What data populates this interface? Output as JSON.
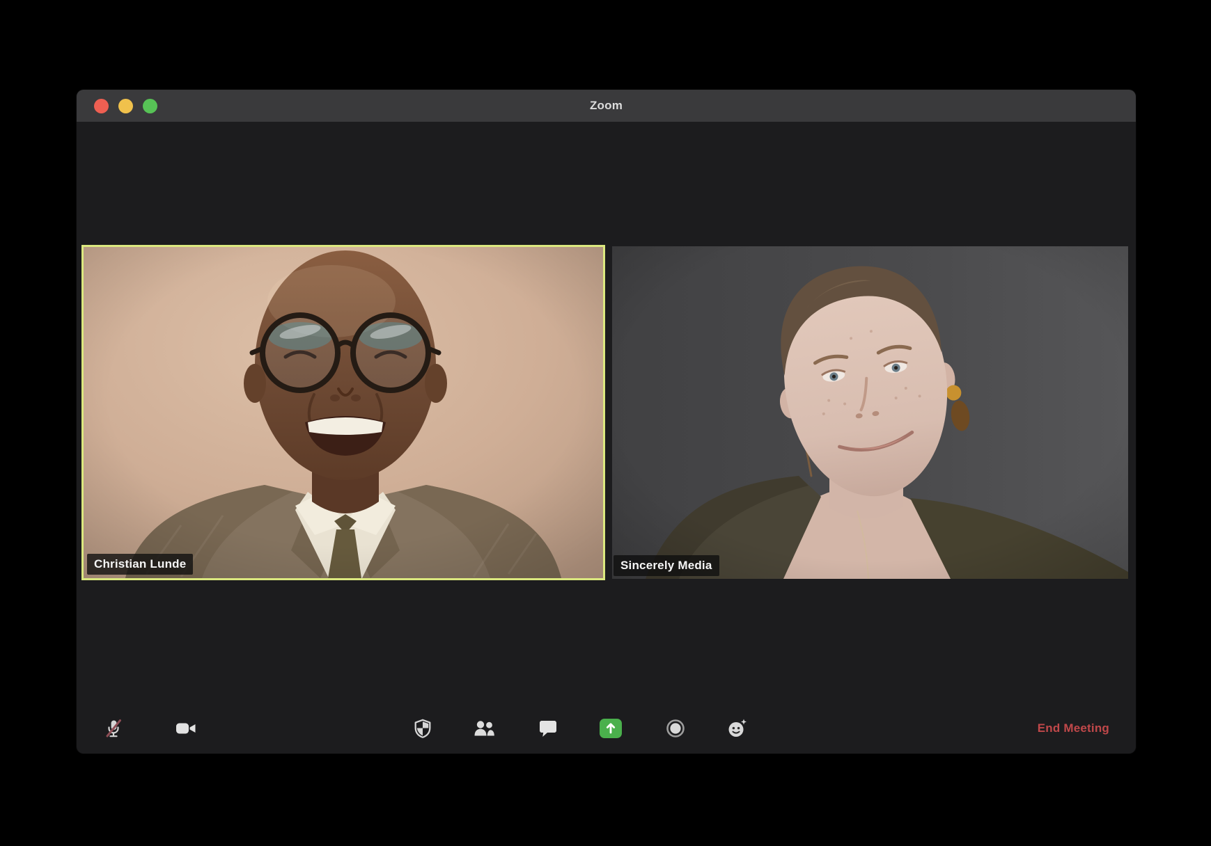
{
  "window": {
    "title": "Zoom"
  },
  "traffic_lights": [
    {
      "id": "close",
      "color": "#ee5f52"
    },
    {
      "id": "minimize",
      "color": "#f0c14c"
    },
    {
      "id": "fullscreen",
      "color": "#57c256"
    }
  ],
  "participants": [
    {
      "name": "Christian Lunde",
      "active_speaker": true
    },
    {
      "name": "Sincerely Media",
      "active_speaker": false
    }
  ],
  "toolbar": {
    "buttons": [
      {
        "id": "mute",
        "icon": "microphone-muted-icon",
        "state": "muted"
      },
      {
        "id": "video",
        "icon": "video-camera-icon"
      },
      {
        "id": "security",
        "icon": "security-shield-icon"
      },
      {
        "id": "participants",
        "icon": "participants-icon"
      },
      {
        "id": "chat",
        "icon": "chat-bubble-icon"
      },
      {
        "id": "share-screen",
        "icon": "share-screen-icon"
      },
      {
        "id": "record",
        "icon": "record-circle-icon"
      },
      {
        "id": "reactions",
        "icon": "reactions-smiley-icon"
      }
    ],
    "end_meeting_label": "End Meeting"
  },
  "colors": {
    "active_speaker_border": "#dbe87f",
    "share_screen_green": "#4ab04c",
    "end_meeting_red": "#c0484a",
    "titlebar_bg": "#3a3a3c",
    "window_bg": "#1c1c1e",
    "mute_slash": "#8d4d55"
  }
}
